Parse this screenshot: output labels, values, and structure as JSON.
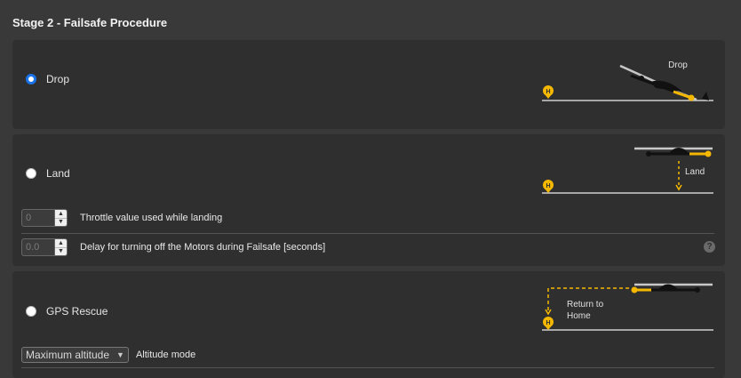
{
  "page": {
    "title": "Stage 2 - Failsafe Procedure"
  },
  "drop": {
    "label": "Drop",
    "checked": true,
    "diagram": {
      "caption": "Drop",
      "home_marker": "H"
    }
  },
  "land": {
    "label": "Land",
    "checked": false,
    "diagram": {
      "caption": "Land",
      "home_marker": "H"
    },
    "throttle": {
      "value": "0",
      "label": "Throttle value used while landing"
    },
    "delay": {
      "value": "0.0",
      "label": "Delay for turning off the Motors during Failsafe [seconds]"
    },
    "help_text": "?"
  },
  "gps": {
    "label": "GPS Rescue",
    "checked": false,
    "diagram": {
      "caption_line1": "Return to",
      "caption_line2": "Home",
      "home_marker": "H"
    },
    "altitude_mode": {
      "selected": "Maximum altitude",
      "label": "Altitude mode"
    }
  },
  "colors": {
    "accent": "#f5b800",
    "radio_checked": "#1a73e8",
    "panel": "#2f2f2f",
    "background": "#393939"
  },
  "icons": {
    "spin_up": "▲",
    "spin_down": "▼",
    "select_chevron": "chevron-down-icon"
  }
}
